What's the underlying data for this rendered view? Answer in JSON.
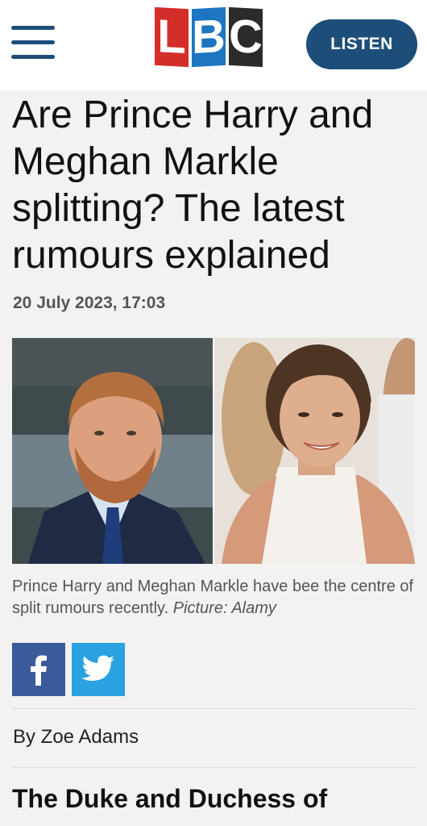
{
  "header": {
    "menu_icon": "hamburger-menu-icon",
    "logo_letters": [
      "L",
      "B",
      "C"
    ],
    "logo_colors": [
      "#d42e2a",
      "#1e76c2",
      "#2b2b2b"
    ],
    "listen_label": "LISTEN"
  },
  "article": {
    "title": "Are Prince Harry and Meghan Markle splitting? The latest rumours explained",
    "date": "20 July 2023, 17:03",
    "caption_text": "Prince Harry and Meghan Markle have bee the centre of split rumours recently.",
    "caption_credit": "Picture: Alamy",
    "byline": "By Zoe Adams",
    "lead_text": "The Duke and Duchess of"
  },
  "share": {
    "facebook_icon": "facebook-icon",
    "twitter_icon": "twitter-icon",
    "facebook_color": "#3b5a9a",
    "twitter_color": "#2aa1e0"
  },
  "colors": {
    "brand_navy": "#1d4e7a",
    "page_background": "#f2f2f2"
  }
}
